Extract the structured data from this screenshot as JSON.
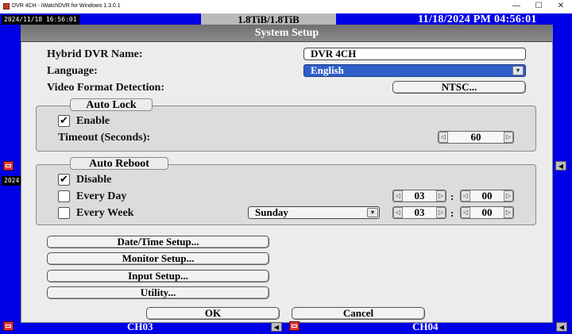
{
  "window": {
    "title": "DVR 4CH - iWatchDVR for Windows 1.3.0.1",
    "minimize_glyph": "—",
    "maximize_glyph": "☐",
    "close_glyph": "✕"
  },
  "statusbar": {
    "small_timestamp": "2024/11/18 16:56:01",
    "capacity": "1.8TiB/1.8TiB",
    "datetime": "11/18/2024 PM 04:56:01",
    "side_stamp": "2024"
  },
  "channels": {
    "bottom_left": "CH03",
    "bottom_right": "CH04"
  },
  "dialog": {
    "title": "System Setup",
    "hybrid_name_label": "Hybrid DVR Name:",
    "hybrid_name_value": "DVR 4CH",
    "language_label": "Language:",
    "language_value": "English",
    "video_format_label": "Video Format Detection:",
    "video_format_button": "NTSC...",
    "auto_lock": {
      "title": "Auto Lock",
      "enable_label": "Enable",
      "enable_checked": true,
      "timeout_label": "Timeout (Seconds):",
      "timeout_value": "60"
    },
    "auto_reboot": {
      "title": "Auto Reboot",
      "disable_label": "Disable",
      "disable_checked": true,
      "every_day_label": "Every Day",
      "every_day_checked": false,
      "every_day_hour": "03",
      "every_day_minute": "00",
      "every_week_label": "Every Week",
      "every_week_checked": false,
      "weekday_value": "Sunday",
      "every_week_hour": "03",
      "every_week_minute": "00",
      "time_separator": ":"
    },
    "buttons": {
      "datetime": "Date/Time Setup...",
      "monitor": "Monitor Setup...",
      "input": "Input Setup...",
      "utility": "Utility...",
      "ok": "OK",
      "cancel": "Cancel"
    }
  },
  "icons": {
    "check": "✔",
    "arrow_left": "◁",
    "arrow_right": "▷",
    "chevron_down": "▾",
    "speaker": "◀"
  },
  "colors": {
    "dvr_background": "#0000e6",
    "dialog_header": "#7a7a7a",
    "language_select": "#2f5ec8",
    "record_indicator": "#e23a3a"
  }
}
